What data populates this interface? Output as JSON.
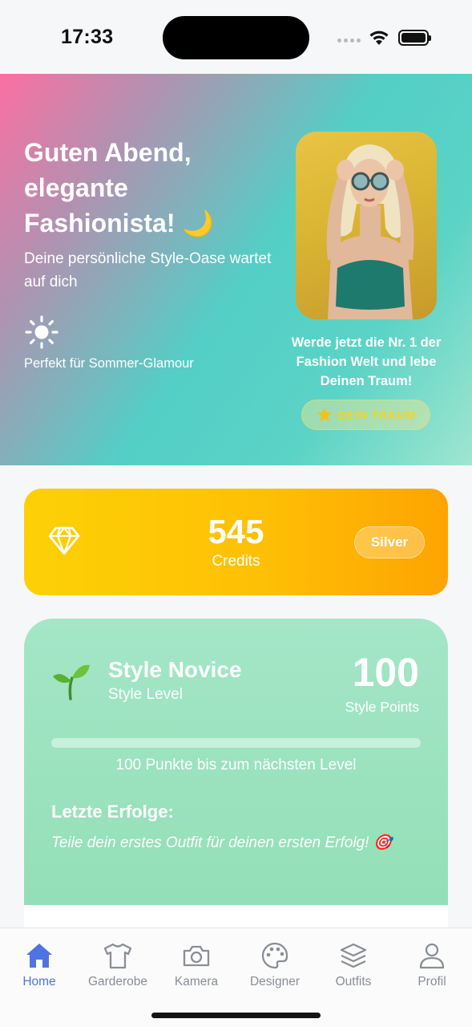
{
  "status_bar": {
    "time": "17:33"
  },
  "hero": {
    "greeting": "Guten Abend, elegante Fashionista! 🌙",
    "subtitle": "Deine persönliche Style-Oase wartet auf dich",
    "weather_icon": "sun-icon",
    "weather_text": "Perfekt für Sommer-Glamour",
    "photo": "fashion-model-photo",
    "motto": "Werde jetzt die Nr. 1 der Fashion Welt und lebe Deinen Traum!",
    "dream_button": {
      "icon": "star-icon",
      "label": "DEIN TRAUM"
    }
  },
  "credits": {
    "icon": "diamond-icon",
    "value": "545",
    "label": "Credits",
    "tier": "Silver",
    "colors": {
      "start": "#fdd106",
      "end": "#fea402"
    }
  },
  "level": {
    "icon": "sprout-icon",
    "name": "Style Novice",
    "caption": "Style Level",
    "points": "100",
    "points_label": "Style Points",
    "progress_fraction": 0,
    "progress_text": "100 Punkte bis zum nächsten Level",
    "achievements_title": "Letzte Erfolge:",
    "achievements_empty": "Teile dein erstes Outfit für deinen ersten Erfolg! 🎯"
  },
  "tabs": [
    {
      "label": "Home",
      "icon": "home-icon",
      "active": true
    },
    {
      "label": "Garderobe",
      "icon": "tshirt-icon",
      "active": false
    },
    {
      "label": "Kamera",
      "icon": "camera-icon",
      "active": false
    },
    {
      "label": "Designer",
      "icon": "palette-icon",
      "active": false
    },
    {
      "label": "Outfits",
      "icon": "layers-icon",
      "active": false
    },
    {
      "label": "Profil",
      "icon": "person-icon",
      "active": false
    }
  ],
  "colors": {
    "accent": "#4f73e0",
    "inactive": "#8b8e96"
  }
}
